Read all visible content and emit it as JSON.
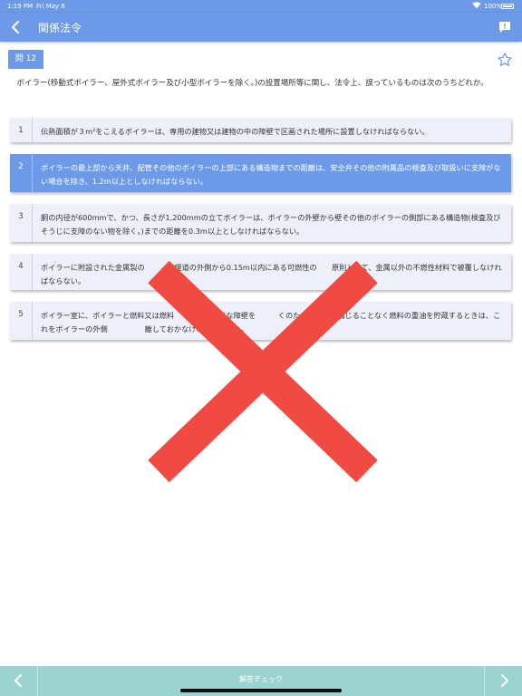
{
  "status_bar": {
    "time": "1:19 PM",
    "date": "Fri May 8",
    "battery": "100%"
  },
  "nav": {
    "title": "関係法令",
    "back_icon": "chevron-left-icon",
    "message_icon": "message-icon"
  },
  "question": {
    "number_label": "問 12",
    "text": "ボイラー(移動式ボイラー、屋外式ボイラー及び小型ボイラーを除く。)の設置場所等に関し、法令上、誤っているものは次のうちどれか。",
    "favorite_icon": "star-outline-icon"
  },
  "options": [
    {
      "num": "1",
      "text": "伝熱面積が３m²をこえるボイラーは、専用の建物又は建物の中の障壁で区画された場所に設置しなければならない。",
      "selected": false
    },
    {
      "num": "2",
      "text": "ボイラーの最上部から天井、配管その他のボイラーの上部にある構造物までの距離は、安全弁その他の附属品の検査及び取扱いに支障がない場合を除き、1.2m以上としなければならない。",
      "selected": true
    },
    {
      "num": "3",
      "text": "胴の内径が600mmで、かつ、長さが1,200mmの立てボイラーは、ボイラーの外壁から壁その他のボイラーの側部にある構造物(検査及びそうじに支障のない物を除く。)までの距離を0.3m以上としなければならない。",
      "selected": false
    },
    {
      "num": "4",
      "text": "ボイラーに附設された金属製の　　　は埋道の外側から0.15m以内にある可燃性の　　原則として、金属以外の不燃性材料で被覆しなければならない。",
      "selected": false
    },
    {
      "num": "5",
      "text": "ボイラー室に、ボイラーと燃料又は燃料　　　間に適当な障壁を　　　くのための措置を講じることなく燃料の重油を貯蔵するときは、これをボイラーの外側　　　　　離しておかなければならない。",
      "selected": false
    }
  ],
  "result": {
    "icon": "wrong-cross-icon",
    "color": "#f04a42"
  },
  "bottom_bar": {
    "check_label": "解答チェック",
    "prev_icon": "chevron-left-icon",
    "next_icon": "chevron-right-icon"
  },
  "colors": {
    "header": "#6c9ae8",
    "selected_option": "#6c9ae8",
    "option_bg": "#eef0f9",
    "bottom_bar": "#9ad3d0"
  }
}
